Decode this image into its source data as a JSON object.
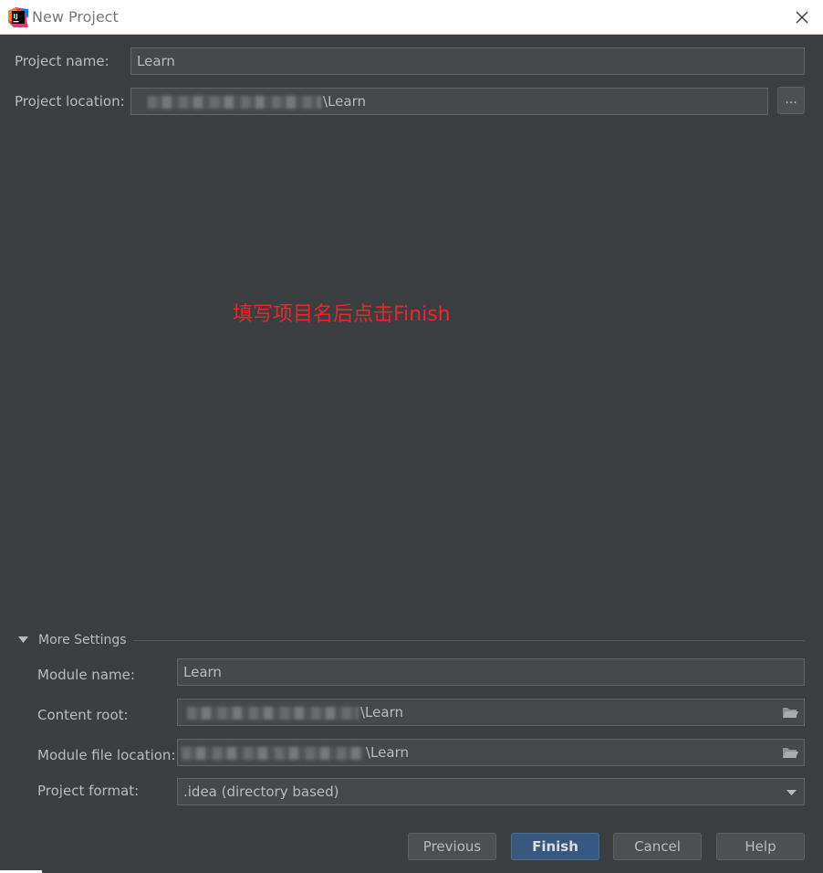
{
  "window": {
    "title": "New Project"
  },
  "form": {
    "project_name_label": "Project name:",
    "project_name_value": "Learn",
    "project_location_label": "Project location:",
    "project_location_suffix": "\\Learn",
    "browse_label": "..."
  },
  "annotation": "填写项目名后点击Finish",
  "more_settings": {
    "header": "More Settings",
    "module_name_label": "Module name:",
    "module_name_value": "Learn",
    "content_root_label": "Content root:",
    "content_root_suffix": "\\Learn",
    "module_file_label": "Module file location:",
    "module_file_suffix": "\\Learn",
    "project_format_label": "Project format:",
    "project_format_value": ".idea (directory based)"
  },
  "buttons": {
    "previous": "Previous",
    "finish": "Finish",
    "cancel": "Cancel",
    "help": "Help"
  },
  "colors": {
    "background": "#3c3f41",
    "annotation": "#e8262c",
    "primary_button": "#365880"
  }
}
